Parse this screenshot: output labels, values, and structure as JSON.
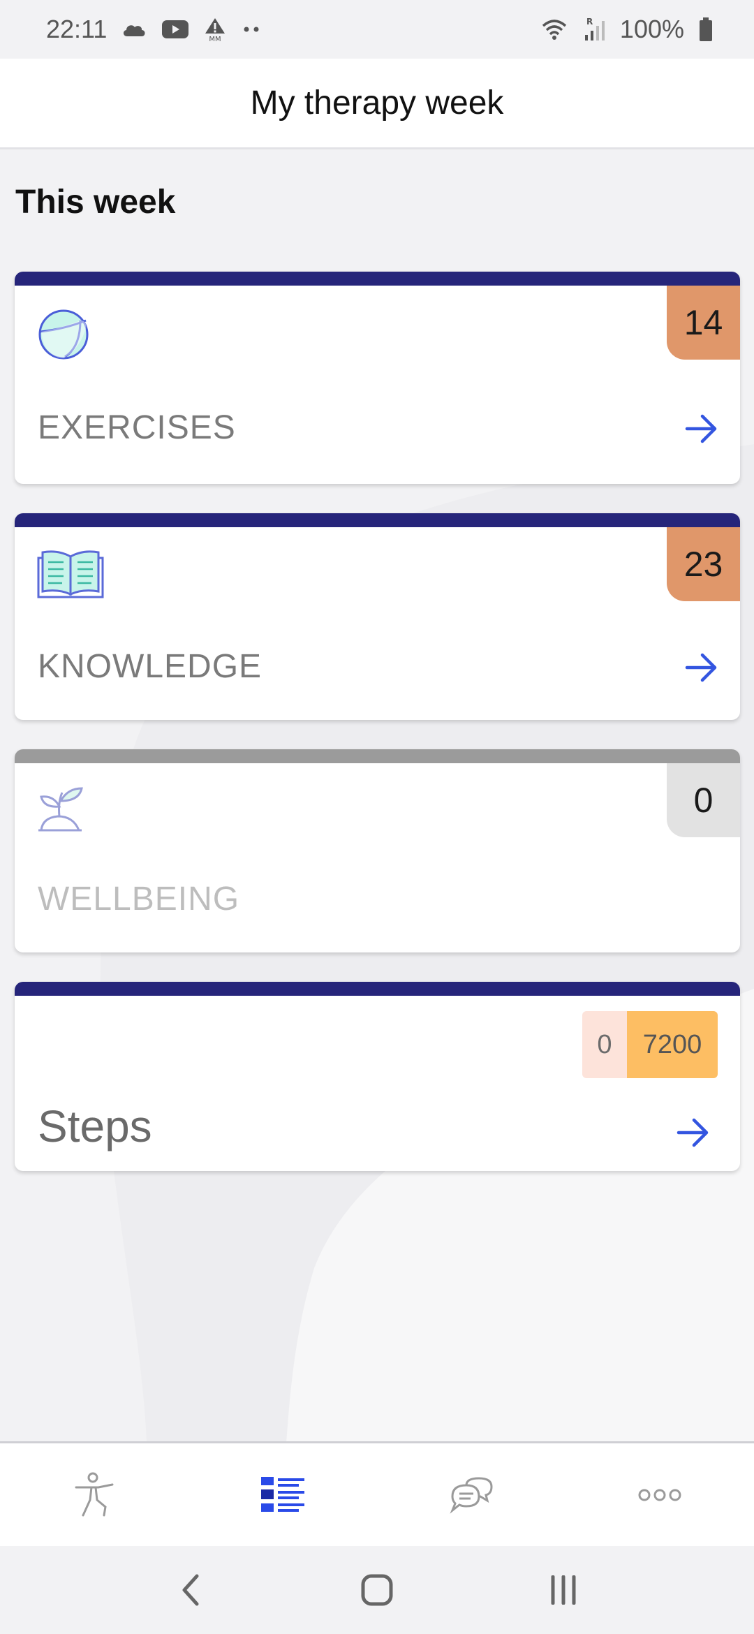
{
  "status_bar": {
    "time": "22:11",
    "battery": "100%",
    "left_icons": [
      "cloud-icon",
      "youtube-icon",
      "alert-icon",
      "more-dots-icon"
    ],
    "right_icons": [
      "wifi-icon",
      "signal-icon",
      "battery-icon"
    ]
  },
  "header": {
    "title": "My therapy week"
  },
  "main": {
    "section_title": "This week",
    "cards": [
      {
        "label": "EXERCISES",
        "count": "14",
        "icon": "exercise-ball-icon",
        "enabled": true,
        "badge_color": "#e0976a"
      },
      {
        "label": "KNOWLEDGE",
        "count": "23",
        "icon": "book-icon",
        "enabled": true,
        "badge_color": "#e0976a"
      },
      {
        "label": "WELLBEING",
        "count": "0",
        "icon": "sprout-icon",
        "enabled": false,
        "badge_color": "#e2e2e2"
      }
    ],
    "steps": {
      "label": "Steps",
      "current": "0",
      "goal": "7200"
    }
  },
  "bottom_nav": {
    "items": [
      {
        "icon": "exercise-person-icon",
        "active": false
      },
      {
        "icon": "list-icon",
        "active": true
      },
      {
        "icon": "chat-icon",
        "active": false
      },
      {
        "icon": "more-horizontal-icon",
        "active": false
      }
    ]
  },
  "system_nav": [
    "back-icon",
    "home-icon",
    "recents-icon"
  ],
  "colors": {
    "card_accent": "#26257a",
    "card_accent_disabled": "#9b9b9b",
    "arrow": "#3355e0",
    "nav_active": "#2a4ae8"
  }
}
